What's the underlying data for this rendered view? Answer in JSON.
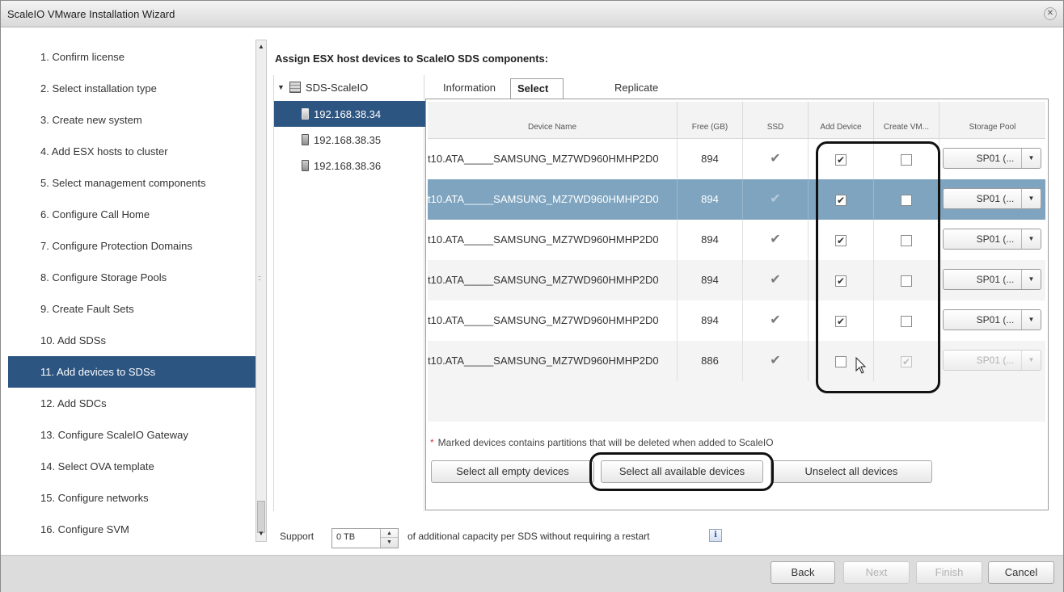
{
  "window": {
    "title": "ScaleIO VMware Installation Wizard",
    "close_icon": "close-icon"
  },
  "steps": [
    {
      "label": "1. Confirm license"
    },
    {
      "label": "2. Select installation type"
    },
    {
      "label": "3. Create new system"
    },
    {
      "label": "4. Add ESX hosts to cluster"
    },
    {
      "label": "5. Select management components"
    },
    {
      "label": "6. Configure Call Home"
    },
    {
      "label": "7. Configure Protection Domains"
    },
    {
      "label": "8. Configure Storage Pools"
    },
    {
      "label": "9. Create Fault Sets"
    },
    {
      "label": "10. Add SDSs"
    },
    {
      "label": "11. Add devices to SDSs",
      "active": true
    },
    {
      "label": "12. Add SDCs"
    },
    {
      "label": "13. Configure ScaleIO Gateway"
    },
    {
      "label": "14. Select OVA template"
    },
    {
      "label": "15. Configure networks"
    },
    {
      "label": "16. Configure SVM"
    }
  ],
  "main": {
    "heading": "Assign ESX host devices to ScaleIO SDS components:",
    "tree": {
      "root": "SDS-ScaleIO",
      "hosts": [
        "192.168.38.34",
        "192.168.38.35",
        "192.168.38.36"
      ],
      "selected_index": 0
    },
    "tabs": [
      "Information",
      "Select devices",
      "Replicate selection"
    ],
    "active_tab": "Select devices",
    "grid": {
      "columns": [
        "Device Name",
        "Free (GB)",
        "SSD",
        "Add Device",
        "Create VM...",
        "Storage Pool"
      ],
      "rows": [
        {
          "device": "t10.ATA_____SAMSUNG_MZ7WD960HMHP2D0",
          "free": "894",
          "ssd": "✔",
          "add": "✔",
          "create_vm": "",
          "pool": "SP01 (...",
          "selected": false,
          "disabled": false
        },
        {
          "device": "t10.ATA_____SAMSUNG_MZ7WD960HMHP2D0",
          "free": "894",
          "ssd": "✔",
          "add": "✔",
          "create_vm": "",
          "pool": "SP01 (...",
          "selected": true,
          "disabled": false
        },
        {
          "device": "t10.ATA_____SAMSUNG_MZ7WD960HMHP2D0",
          "free": "894",
          "ssd": "✔",
          "add": "✔",
          "create_vm": "",
          "pool": "SP01 (...",
          "selected": false,
          "disabled": false
        },
        {
          "device": "t10.ATA_____SAMSUNG_MZ7WD960HMHP2D0",
          "free": "894",
          "ssd": "✔",
          "add": "✔",
          "create_vm": "",
          "pool": "SP01 (...",
          "selected": false,
          "disabled": false
        },
        {
          "device": "t10.ATA_____SAMSUNG_MZ7WD960HMHP2D0",
          "free": "894",
          "ssd": "✔",
          "add": "✔",
          "create_vm": "",
          "pool": "SP01 (...",
          "selected": false,
          "disabled": false
        },
        {
          "device": "t10.ATA_____SAMSUNG_MZ7WD960HMHP2D0",
          "free": "886",
          "ssd": "✔",
          "add": "",
          "create_vm": "✔",
          "pool": "SP01 (...",
          "selected": false,
          "disabled": true
        }
      ]
    },
    "note_star": "*",
    "note": "Marked devices contains partitions that will be deleted when added to ScaleIO",
    "buttons": {
      "select_empty": "Select all empty devices",
      "select_available": "Select all available devices",
      "unselect_all": "Unselect all devices"
    },
    "support": {
      "label": "Support",
      "value": "0 TB",
      "suffix": "of additional capacity per SDS without requiring a restart",
      "info": "i"
    }
  },
  "footer": {
    "back": "Back",
    "next": "Next",
    "finish": "Finish",
    "cancel": "Cancel"
  },
  "colors": {
    "selection": "#2d5581",
    "row_selected": "#7fa4bf",
    "footer": "#dcdcdc"
  }
}
